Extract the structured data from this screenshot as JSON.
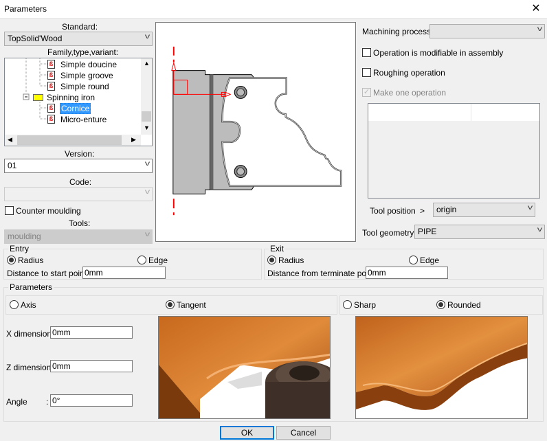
{
  "window": {
    "title": "Parameters",
    "close_icon": "close-icon"
  },
  "left": {
    "standard_label": "Standard:",
    "standard_value": "TopSolid'Wood",
    "family_label": "Family,type,variant:",
    "tree": [
      {
        "label": "Simple doucine",
        "type": "file"
      },
      {
        "label": "Simple groove",
        "type": "file"
      },
      {
        "label": "Simple round",
        "type": "file"
      },
      {
        "label": "Spinning iron",
        "type": "folder",
        "expanded": true
      },
      {
        "label": "Cornice",
        "type": "file",
        "selected": true
      },
      {
        "label": "Micro-enture",
        "type": "file"
      }
    ],
    "version_label": "Version:",
    "version_value": "01",
    "code_label": "Code:",
    "code_value": "",
    "counter_moulding_label": "Counter moulding",
    "counter_moulding_checked": false,
    "tools_label": "Tools:",
    "tools_value": "moulding"
  },
  "right": {
    "machining_label": "Machining process >",
    "machining_value": "",
    "modifiable_label": "Operation is modifiable in assembly",
    "modifiable_checked": false,
    "roughing_label": "Roughing operation",
    "roughing_checked": false,
    "one_op_label": "Make one operation",
    "one_op_checked": true,
    "tool_position_label": "Tool position",
    "tool_position_arrow": ">",
    "tool_position_value": "origin",
    "tool_geometry_label": "Tool geometry >",
    "tool_geometry_value": "PIPE"
  },
  "entry": {
    "title": "Entry",
    "radius": "Radius",
    "edge": "Edge",
    "selected": "Radius",
    "distance_label": "Distance to start point :",
    "distance_value": "0mm"
  },
  "exit": {
    "title": "Exit",
    "radius": "Radius",
    "edge": "Edge",
    "selected": "Radius",
    "distance_label": "Distance from terminate point :",
    "distance_value": "0mm"
  },
  "parameters": {
    "title": "Parameters",
    "axis": "Axis",
    "tangent": "Tangent",
    "approach_selected": "Tangent",
    "sharp": "Sharp",
    "rounded": "Rounded",
    "corner_selected": "Rounded",
    "x_label": "X dimension :",
    "x_value": "0mm",
    "z_label": "Z dimension :",
    "z_value": "0mm",
    "angle_label": "Angle",
    "angle_colon": ":",
    "angle_value": "0°"
  },
  "buttons": {
    "ok": "OK",
    "cancel": "Cancel"
  },
  "colors": {
    "selection": "#3399ff",
    "red_axis": "#ff0000",
    "default_button_border": "#0078d7"
  }
}
